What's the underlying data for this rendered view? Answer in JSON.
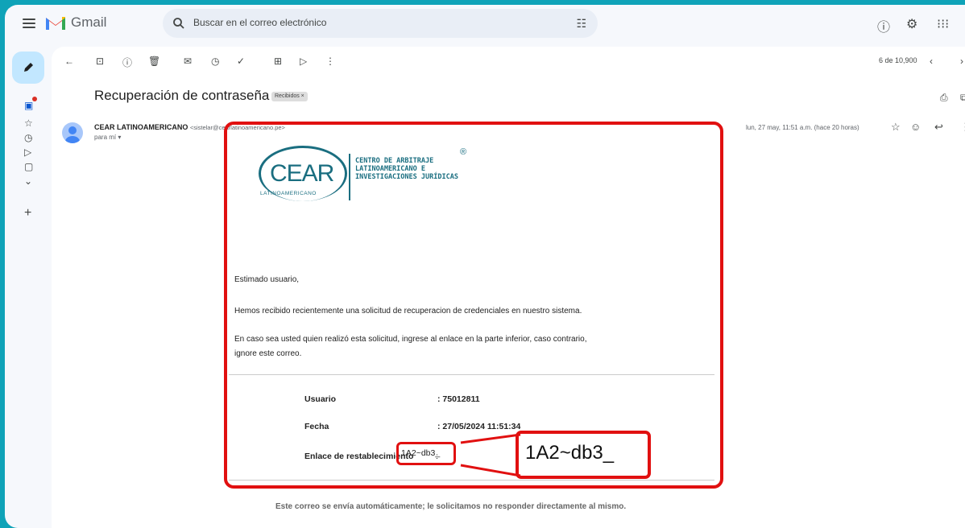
{
  "app": {
    "name": "Gmail"
  },
  "search": {
    "placeholder": "Buscar en el correo electrónico"
  },
  "toolbar": {
    "message_count": "6 de 10,900"
  },
  "email": {
    "subject": "Recuperación de contraseña",
    "label": "Recibidos ×",
    "sender_name": "CEAR LATINOAMERICANO",
    "sender_address": "<sistelar@cearlatinoamericano.pe>",
    "to": "para mí ▾",
    "date": "lun, 27 may, 11:51 a.m. (hace 20 horas)"
  },
  "body": {
    "logo_text": "CEAR",
    "logo_subtext": "LATINOAMERICANO",
    "org_name_line1": "CENTRO DE ARBITRAJE",
    "org_name_line2": "LATINOAMERICANO E",
    "org_name_line3": "INVESTIGACIONES JURÍDICAS",
    "greeting": "Estimado usuario,",
    "paragraph1": "Hemos recibido recientemente una solicitud de recuperacion de credenciales en nuestro sistema.",
    "paragraph2_line1": "En caso sea usted quien realizó esta solicitud, ingrese al enlace en la parte inferior, caso contrario,",
    "paragraph2_line2": "ignore este correo.",
    "user_label": "Usuario",
    "user_value": ": 75012811",
    "date_label": "Fecha",
    "date_value": ": 27/05/2024 11:51:34",
    "link_label": "Enlace de restablecimiento",
    "link_colon": ":",
    "link_value": "1A2~db3_",
    "link_zoom": "1A2~db3_",
    "footer": "Este correo se envía automáticamente; le solicitamos no responder directamente al mismo."
  },
  "colors": {
    "highlight": "#e11010",
    "brand": "#1a6e80",
    "frame": "#0fa3b8"
  }
}
